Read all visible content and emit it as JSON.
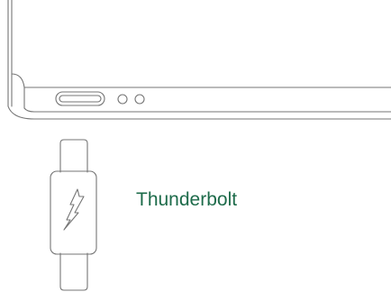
{
  "label": {
    "text": "Thunderbolt",
    "color": "#1d6b4a"
  },
  "colors": {
    "line": "#757575",
    "background": "#ffffff"
  },
  "icons": {
    "laptop": "laptop-side-icon",
    "port": "usb-c-port-icon",
    "leds": "status-light-icon",
    "connector": "usb-c-connector-icon",
    "bolt": "lightning-bolt-icon"
  }
}
